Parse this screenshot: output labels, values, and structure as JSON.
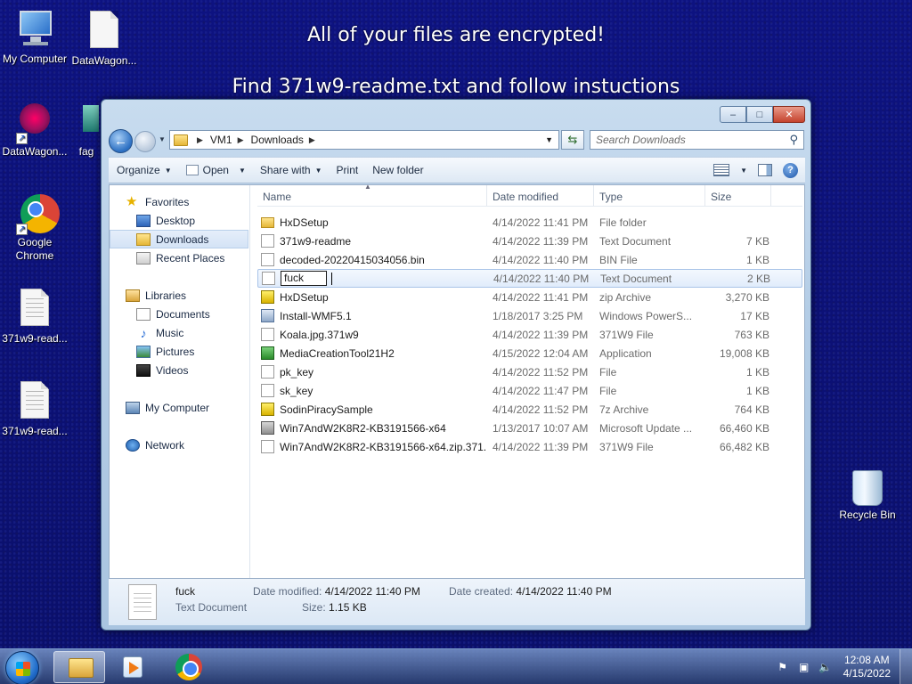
{
  "banner": {
    "line1": "All of your files are encrypted!",
    "line2": "Find 371w9-readme.txt and follow instuctions"
  },
  "desktop_icons": [
    {
      "label": "My Computer"
    },
    {
      "label": "DataWagon..."
    },
    {
      "label": "DataWagon..."
    },
    {
      "label": "fag"
    },
    {
      "label": "Google Chrome"
    },
    {
      "label": "371w9-read..."
    },
    {
      "label": "371w9-read..."
    },
    {
      "label": "Recycle Bin"
    }
  ],
  "window": {
    "controls": {
      "minimize": "–",
      "maximize": "□",
      "close": "✕"
    },
    "address": {
      "segments": [
        "VM1",
        "Downloads"
      ]
    },
    "search_placeholder": "Search Downloads",
    "commands": {
      "organize": "Organize",
      "open": "Open",
      "share_with": "Share with",
      "print": "Print",
      "new_folder": "New folder"
    },
    "nav": {
      "favorites": "Favorites",
      "desktop": "Desktop",
      "downloads": "Downloads",
      "recent_places": "Recent Places",
      "libraries": "Libraries",
      "documents": "Documents",
      "music": "Music",
      "pictures": "Pictures",
      "videos": "Videos",
      "my_computer": "My Computer",
      "network": "Network"
    },
    "columns": {
      "name": "Name",
      "date": "Date modified",
      "type": "Type",
      "size": "Size"
    },
    "files": [
      {
        "name": "HxDSetup",
        "date": "4/14/2022 11:41 PM",
        "type": "File folder",
        "size": "",
        "icon": "folder-icon"
      },
      {
        "name": "371w9-readme",
        "date": "4/14/2022 11:39 PM",
        "type": "Text Document",
        "size": "7 KB",
        "icon": "text-file-icon"
      },
      {
        "name": "decoded-20220415034056.bin",
        "date": "4/14/2022 11:40 PM",
        "type": "BIN File",
        "size": "1 KB",
        "icon": "text-file-icon"
      },
      {
        "name": "fuck",
        "date": "4/14/2022 11:40 PM",
        "type": "Text Document",
        "size": "2 KB",
        "icon": "text-file-icon"
      },
      {
        "name": "HxDSetup",
        "date": "4/14/2022 11:41 PM",
        "type": "zip Archive",
        "size": "3,270 KB",
        "icon": "zip-icon"
      },
      {
        "name": "Install-WMF5.1",
        "date": "1/18/2017 3:25 PM",
        "type": "Windows PowerS...",
        "size": "17 KB",
        "icon": "powershell-icon"
      },
      {
        "name": "Koala.jpg.371w9",
        "date": "4/14/2022 11:39 PM",
        "type": "371W9 File",
        "size": "763 KB",
        "icon": "text-file-icon"
      },
      {
        "name": "MediaCreationTool21H2",
        "date": "4/15/2022 12:04 AM",
        "type": "Application",
        "size": "19,008 KB",
        "icon": "app-icon"
      },
      {
        "name": "pk_key",
        "date": "4/14/2022 11:52 PM",
        "type": "File",
        "size": "1 KB",
        "icon": "text-file-icon"
      },
      {
        "name": "sk_key",
        "date": "4/14/2022 11:47 PM",
        "type": "File",
        "size": "1 KB",
        "icon": "text-file-icon"
      },
      {
        "name": "SodinPiracySample",
        "date": "4/14/2022 11:52 PM",
        "type": "7z Archive",
        "size": "764 KB",
        "icon": "zip-icon"
      },
      {
        "name": "Win7AndW2K8R2-KB3191566-x64",
        "date": "1/13/2017 10:07 AM",
        "type": "Microsoft Update ...",
        "size": "66,460 KB",
        "icon": "msu-icon"
      },
      {
        "name": "Win7AndW2K8R2-KB3191566-x64.zip.371...",
        "date": "4/14/2022 11:39 PM",
        "type": "371W9 File",
        "size": "66,482 KB",
        "icon": "text-file-icon"
      }
    ],
    "details": {
      "name": "fuck",
      "type": "Text Document",
      "date_modified_label": "Date modified:",
      "date_modified": "4/14/2022 11:40 PM",
      "date_created_label": "Date created:",
      "date_created": "4/14/2022 11:40 PM",
      "size_label": "Size:",
      "size": "1.15 KB"
    }
  },
  "taskbar": {
    "time": "12:08 AM",
    "date": "4/15/2022"
  }
}
